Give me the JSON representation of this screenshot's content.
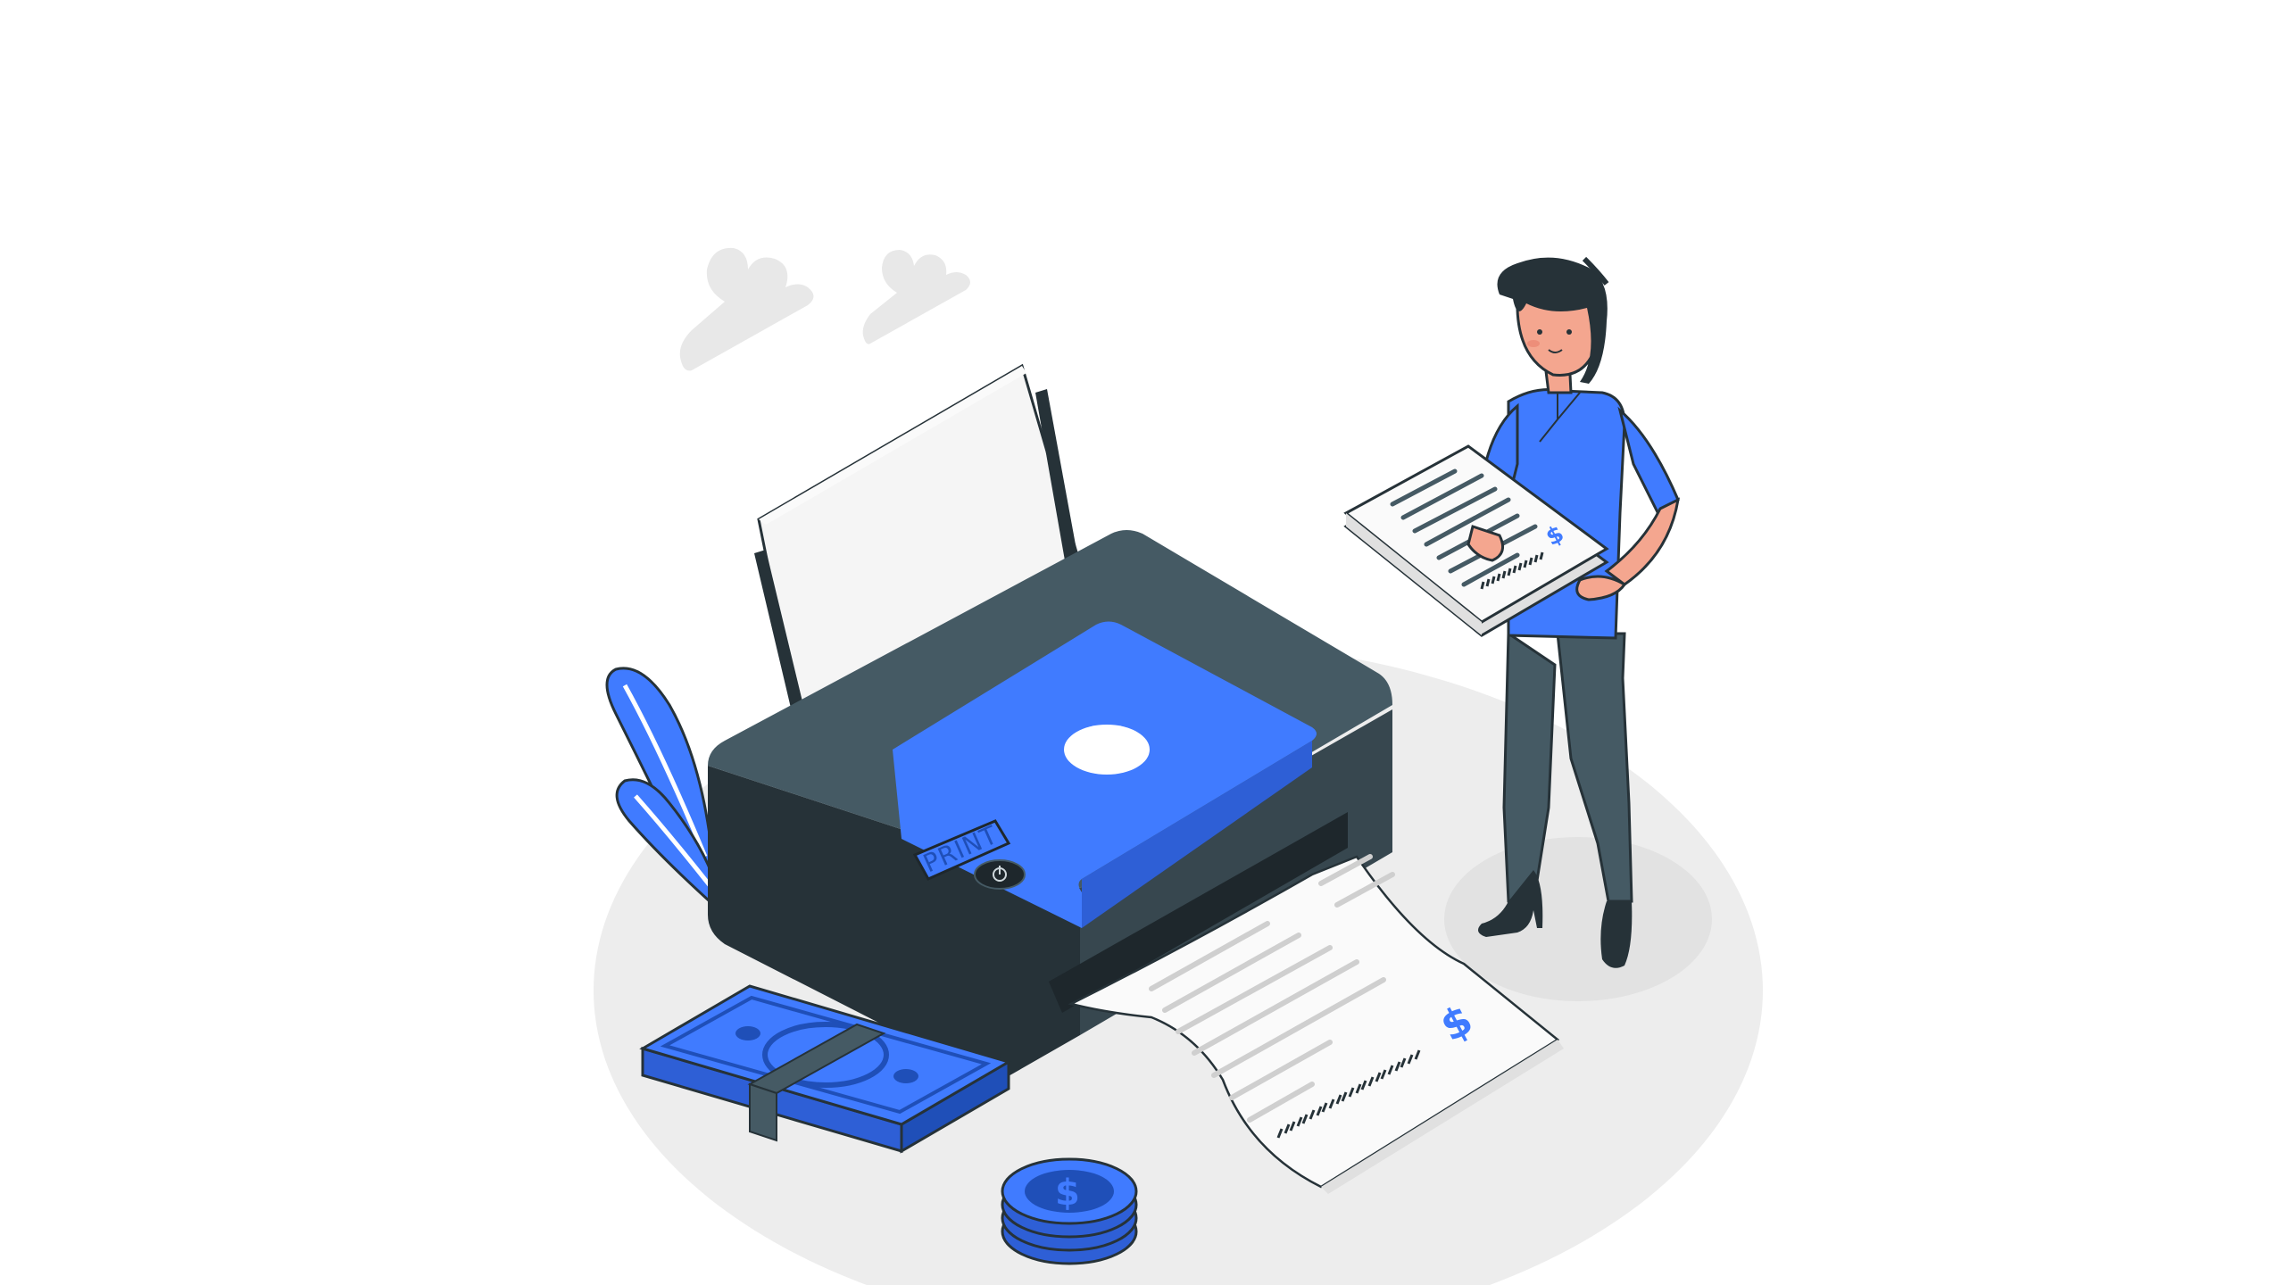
{
  "colors": {
    "background": "#ffffff",
    "floor": "#ededed",
    "floor_shadow": "#e2e2e2",
    "cloud": "#e8e8e8",
    "printer_top": "#455a64",
    "printer_front": "#263238",
    "printer_dark": "#1e272c",
    "accent_blue": "#407bff",
    "accent_blue_dark": "#2e5fd6",
    "accent_blue_deep": "#1f4fb8",
    "paper": "#fafafa",
    "paper_shade": "#e0e0e0",
    "paper_lines": "#cfcfcf",
    "barcode": "#263238",
    "skin": "#f4a68f",
    "hair": "#263238",
    "pants": "#455a64",
    "shoes": "#263238"
  },
  "printer": {
    "display_label": "PRINT",
    "power_icon": "power-icon"
  },
  "receipt": {
    "currency_symbol": "$"
  },
  "held_stack": {
    "currency_symbol": "$"
  },
  "coins": {
    "currency_symbol": "$"
  },
  "icons": [
    "cloud-icon",
    "plant-icon",
    "banknote-stack-icon",
    "coin-stack-icon",
    "power-icon",
    "barcode-icon",
    "dollar-icon"
  ]
}
